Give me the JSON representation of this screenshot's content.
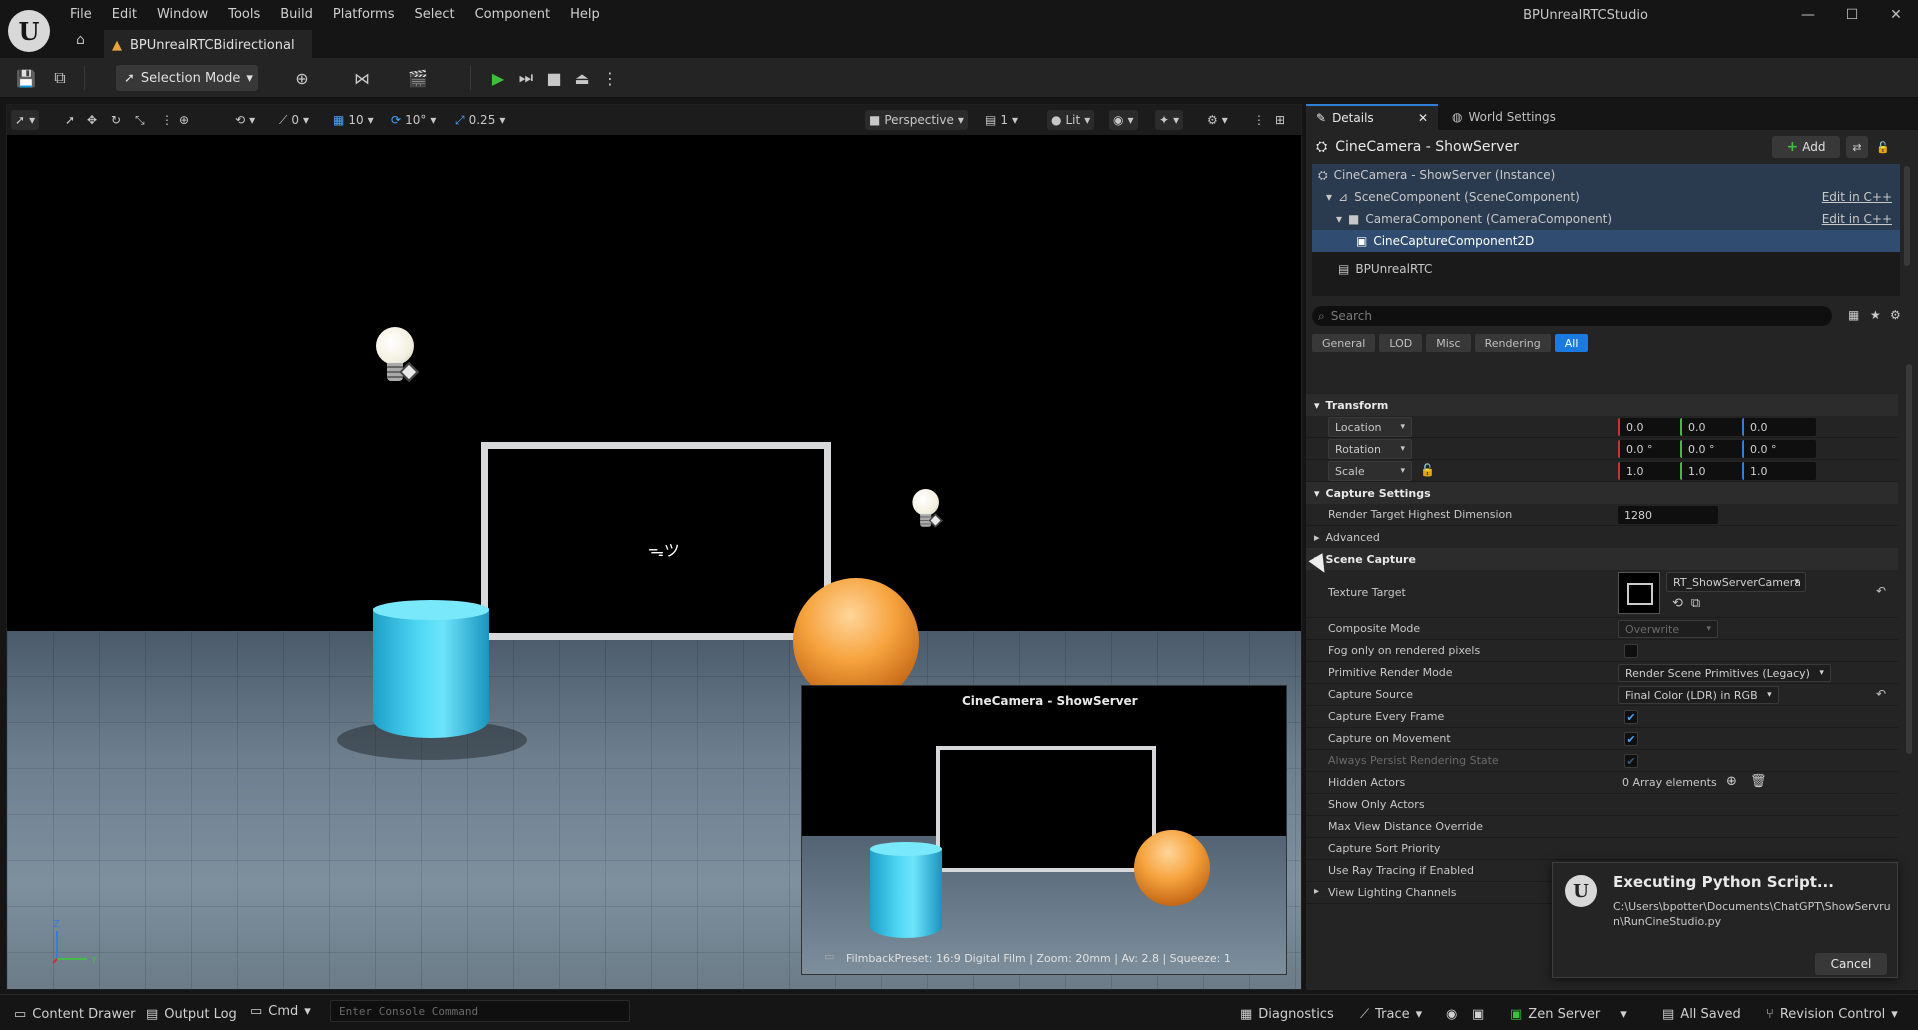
{
  "app": {
    "title": "BPUnrealRTCStudio",
    "logo": "U"
  },
  "menu": [
    "File",
    "Edit",
    "Window",
    "Tools",
    "Build",
    "Platforms",
    "Select",
    "Component",
    "Help"
  ],
  "doc_tab": {
    "label": "BPUnrealRTCBidirectional"
  },
  "toolbar": {
    "selection_mode": "Selection Mode"
  },
  "viewport": {
    "snap_rotation": "0",
    "grid": "10",
    "rot_snap": "10°",
    "scale_snap": "0.25",
    "view_mode": "Perspective",
    "camera_speed": "1",
    "lit_mode": "Lit",
    "screen_glyph": "ᯓツ",
    "pip": {
      "title": "CineCamera - ShowServer",
      "caption": "FilmbackPreset: 16:9 Digital Film | Zoom: 20mm | Av: 2.8 | Squeeze: 1"
    },
    "axis": {
      "z": "Z",
      "y": "Y"
    }
  },
  "details": {
    "tabs": [
      {
        "label": "Details"
      },
      {
        "label": "World Settings"
      }
    ],
    "actor_title": "CineCamera - ShowServer",
    "add_label": "Add",
    "tree": [
      {
        "label": "CineCamera - ShowServer (Instance)",
        "edit": ""
      },
      {
        "label": "SceneComponent (SceneComponent)",
        "edit": "Edit in C++"
      },
      {
        "label": "CameraComponent (CameraComponent)",
        "edit": "Edit in C++"
      },
      {
        "label": "CineCaptureComponent2D",
        "edit": ""
      },
      {
        "label": "BPUnrealRTC",
        "edit": ""
      }
    ],
    "search_placeholder": "Search",
    "filters": [
      "General",
      "LOD",
      "Misc",
      "Rendering",
      "All"
    ],
    "transform": {
      "category": "Transform",
      "location_label": "Location",
      "rotation_label": "Rotation",
      "scale_label": "Scale",
      "location": [
        "0.0",
        "0.0",
        "0.0"
      ],
      "rotation": [
        "0.0 °",
        "0.0 °",
        "0.0 °"
      ],
      "scale": [
        "1.0",
        "1.0",
        "1.0"
      ]
    },
    "capture_settings": {
      "category": "Capture Settings",
      "render_target_label": "Render Target Highest Dimension",
      "render_target_value": "1280",
      "advanced": "Advanced"
    },
    "scene_capture": {
      "category": "Scene Capture",
      "texture_target_label": "Texture Target",
      "texture_target_value": "RT_ShowServerCamera",
      "composite_mode_label": "Composite Mode",
      "composite_mode_value": "Overwrite",
      "fog_label": "Fog only on rendered pixels",
      "primitive_label": "Primitive Render Mode",
      "primitive_value": "Render Scene Primitives (Legacy)",
      "capture_source_label": "Capture Source",
      "capture_source_value": "Final Color (LDR) in RGB",
      "every_frame_label": "Capture Every Frame",
      "on_movement_label": "Capture on Movement",
      "persist_label": "Always Persist Rendering State",
      "hidden_actors_label": "Hidden Actors",
      "hidden_actors_value": "0 Array elements",
      "show_only_label": "Show Only Actors",
      "max_view_label": "Max View Distance Override",
      "sort_priority_label": "Capture Sort Priority",
      "ray_tracing_label": "Use Ray Tracing if Enabled",
      "lighting_channels_label": "View Lighting Channels"
    }
  },
  "popup": {
    "title": "Executing Python Script...",
    "path": "C:\\Users\\bpotter\\Documents\\ChatGPT\\ShowServrun\\RunCineStudio.py",
    "cancel": "Cancel"
  },
  "statusbar": {
    "content_drawer": "Content Drawer",
    "output_log": "Output Log",
    "cmd": "Cmd",
    "console_placeholder": "Enter Console Command",
    "diagnostics": "Diagnostics",
    "trace": "Trace",
    "zen_server": "Zen Server",
    "all_saved": "All Saved",
    "revision_control": "Revision Control"
  }
}
